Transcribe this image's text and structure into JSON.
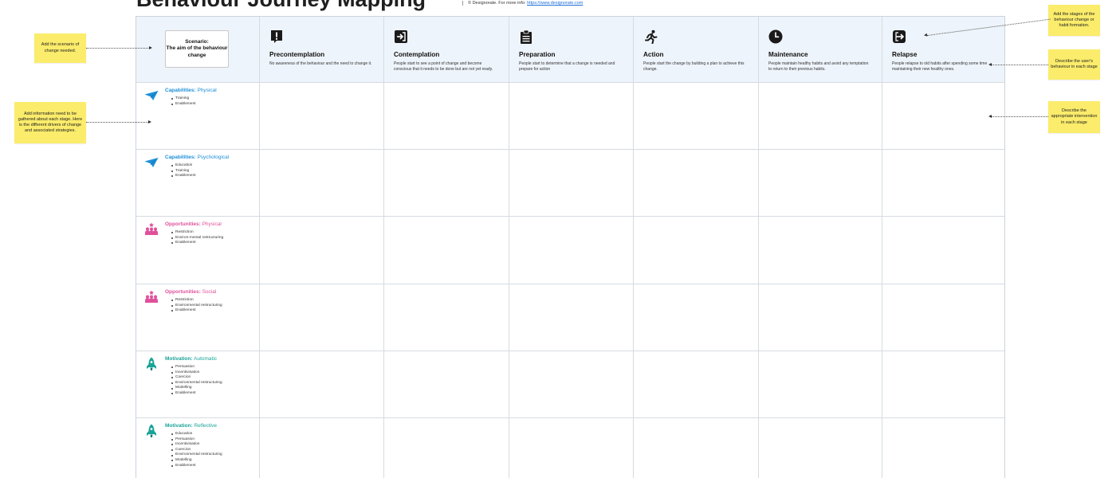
{
  "page": {
    "title": "Behaviour Journey Mapping",
    "credit_text": "© Designorate. For more info: ",
    "credit_link": "https://www.designorate.com"
  },
  "scenario": {
    "label": "Scenario:",
    "text": "The aim of the behaviour change"
  },
  "stages": [
    {
      "name": "Precontemplation",
      "icon": "exclamation-icon",
      "desc": "No awareness of the behaviour and the need to change it."
    },
    {
      "name": "Contemplation",
      "icon": "sign-in-icon",
      "desc": "People start to see a point of change and become conscious that it needs to be done but are not yet ready."
    },
    {
      "name": "Preparation",
      "icon": "clipboard-icon",
      "desc": "People start to determine that a change is needed and prepare for action"
    },
    {
      "name": "Action",
      "icon": "running-person-icon",
      "desc": "People start the change by building a plan to achieve this change."
    },
    {
      "name": "Maintenance",
      "icon": "clock-icon",
      "desc": "People maintain healthy habits and avoid any temptation to return to their previous habits."
    },
    {
      "name": "Relapse",
      "icon": "sign-out-icon",
      "desc": "People relapse to old habits after spending some time maintaining their new healthy ones."
    }
  ],
  "categories": [
    {
      "group": "Capabilities:",
      "sub": "Physical",
      "icon": "paper-plane-icon",
      "color": "#1d8fd8",
      "items": [
        "Training",
        "Enablement"
      ]
    },
    {
      "group": "Capabilities:",
      "sub": "Psychological",
      "icon": "paper-plane-icon",
      "color": "#1d8fd8",
      "items": [
        "Education",
        "Training",
        "Enablement"
      ]
    },
    {
      "group": "Opportunities:",
      "sub": "Physical",
      "icon": "people-group-icon",
      "color": "#e0509a",
      "items": [
        "Restriction",
        "Environ-mental restructuring",
        "Enablement"
      ]
    },
    {
      "group": "Opportunities:",
      "sub": "Social",
      "icon": "people-group-icon",
      "color": "#e0509a",
      "items": [
        "Restriction",
        "Environmental restructuring",
        "Enablement"
      ]
    },
    {
      "group": "Motivation:",
      "sub": "Automatic",
      "icon": "rocket-icon",
      "color": "#1aa398",
      "items": [
        "Persuasion",
        "Incentivisation",
        "Coercion",
        "Environmental restructuring",
        "Modelling",
        "Enablement"
      ]
    },
    {
      "group": "Motivation:",
      "sub": "Reflective",
      "icon": "rocket-icon",
      "color": "#1aa398",
      "items": [
        "Education",
        "Persuasion",
        "Incentivisation",
        "Coercion",
        "Environmental restructuring",
        "Modelling",
        "Enablement"
      ]
    }
  ],
  "notes": {
    "scenario": "Add the scenario of change needed.",
    "information": "Add information need to be gathered about each stage. Here is the different drivers of change and associated strategies.",
    "stages": "Add the stages of the behaviour change or habit formation.",
    "behaviour": "Describe the user's behaviour in each stage",
    "intervention": "Describe the appropriate intervention in each stage"
  },
  "colors": {
    "header_band": "#eef4fb",
    "sticky_note": "#fbec6b",
    "link": "#1f6fd8"
  }
}
